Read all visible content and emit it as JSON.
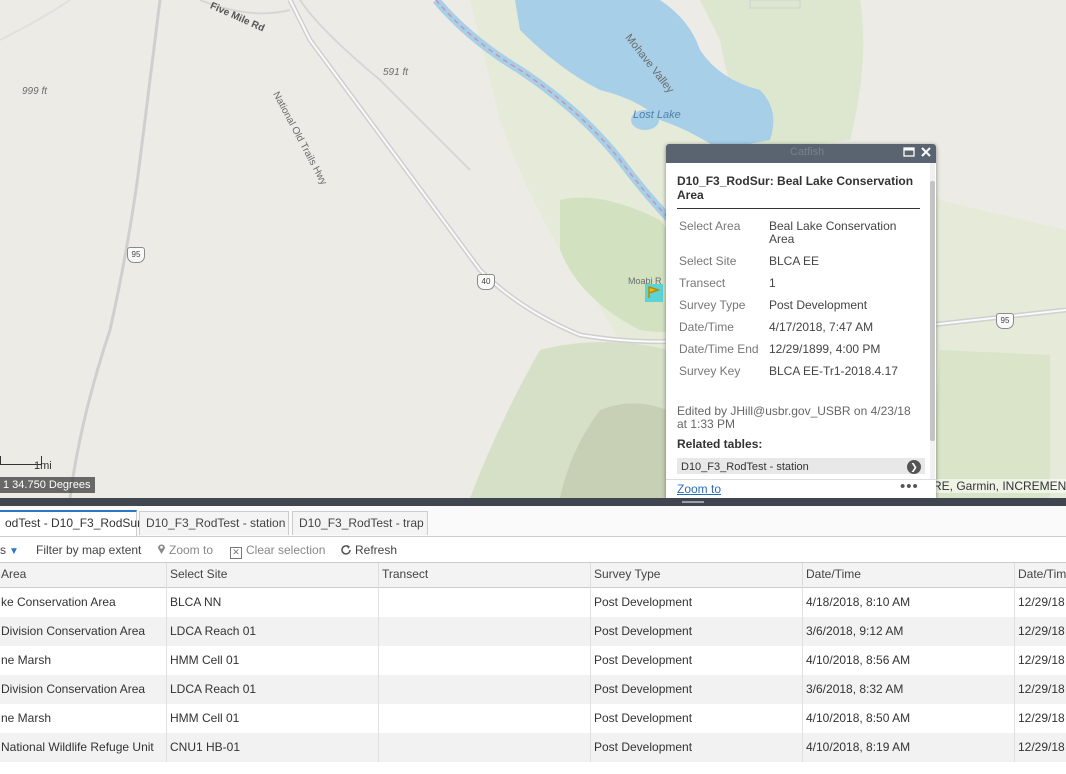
{
  "map": {
    "labels": {
      "five_mile_rd": "Five Mile Rd",
      "national_old_trails_hwy": "National Old Trails Hwy",
      "elev_591": "591 ft",
      "elev_999": "999 ft",
      "mohave_valley": "Mohave Valley",
      "lost_lake": "Lost Lake",
      "catfish": "Catfish",
      "moabi": "Moabi R"
    },
    "shields": {
      "us95_left": "95",
      "i40": "40",
      "us95_right": "95"
    },
    "scale_label": "1mi",
    "coords": "1 34.750 Degrees",
    "attribution": "RE, Garmin, INCREMENT"
  },
  "popup": {
    "header_ghost": "Catfish",
    "maximize_icon": "window-maximize-icon",
    "close_icon": "close-icon",
    "title": "D10_F3_RodSur: Beal Lake Conservation Area",
    "attributes": [
      {
        "key": "Select Area",
        "value": "Beal Lake Conservation Area"
      },
      {
        "key": "Select Site",
        "value": "BLCA EE"
      },
      {
        "key": "Transect",
        "value": "1"
      },
      {
        "key": "Survey Type",
        "value": "Post Development"
      },
      {
        "key": "Date/Time",
        "value": "4/17/2018, 7:47 AM"
      },
      {
        "key": "Date/Time End",
        "value": "12/29/1899, 4:00 PM"
      },
      {
        "key": "Survey Key",
        "value": "BLCA EE-Tr1-2018.4.17"
      }
    ],
    "edit_info": "Edited by JHill@usbr.gov_USBR on 4/23/18 at 1:33 PM",
    "related_label": "Related tables:",
    "related_item": "D10_F3_RodTest - station",
    "zoom_to": "Zoom to",
    "more": "•••"
  },
  "tabs": [
    {
      "label": "odTest - D10_F3_RodSur",
      "active": true
    },
    {
      "label": "D10_F3_RodTest - station",
      "active": false
    },
    {
      "label": "D10_F3_RodTest - trap",
      "active": false
    }
  ],
  "toolbar": {
    "options_label": "s",
    "filter_label": "Filter by map extent",
    "zoom_label": "Zoom to",
    "clear_label": "Clear selection",
    "refresh_label": "Refresh"
  },
  "grid": {
    "columns": [
      "Area",
      "Select Site",
      "Transect",
      "Survey Type",
      "Date/Time",
      "Date/Tim"
    ],
    "rows": [
      [
        "ke Conservation Area",
        "BLCA NN",
        "",
        "Post Development",
        "4/18/2018, 8:10 AM",
        "12/29/18"
      ],
      [
        "Division Conservation Area",
        "LDCA Reach 01",
        "",
        "Post Development",
        "3/6/2018, 9:12 AM",
        "12/29/18"
      ],
      [
        "ne Marsh",
        "HMM Cell 01",
        "",
        "Post Development",
        "4/10/2018, 8:56 AM",
        "12/29/18"
      ],
      [
        "Division Conservation Area",
        "LDCA Reach 01",
        "",
        "Post Development",
        "3/6/2018, 8:32 AM",
        "12/29/18"
      ],
      [
        "ne Marsh",
        "HMM Cell 01",
        "",
        "Post Development",
        "4/10/2018, 8:50 AM",
        "12/29/18"
      ],
      [
        "National Wildlife Refuge Unit",
        "CNU1 HB-01",
        "",
        "Post Development",
        "4/10/2018, 8:19 AM",
        "12/29/18"
      ]
    ]
  }
}
